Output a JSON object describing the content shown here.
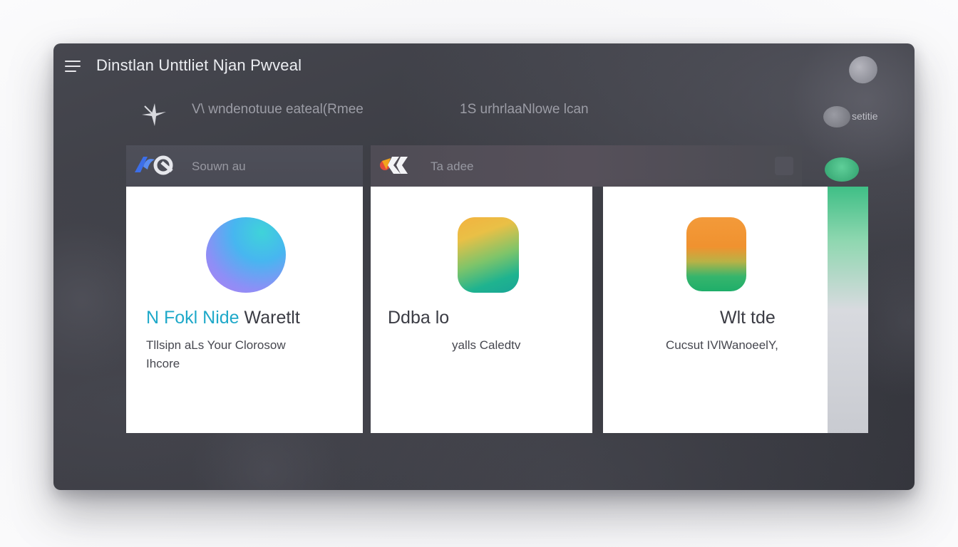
{
  "window": {
    "title": "Dinstlan Unttliet Njan Pwveal"
  },
  "subbar": {
    "text_left": "V\\ wndenotuue eateal(Rmee",
    "text_right": "1S urhrlaaNlowe lcan",
    "settings_label": "setitie"
  },
  "tabs": [
    {
      "label": "Souwn au"
    },
    {
      "label": "Ta adee"
    }
  ],
  "cards": [
    {
      "title_part1": "N  Fokl  Nide",
      "title_part2": "Waretlt",
      "desc_line1": "Tllsipn aLs  Your  Clorosow",
      "desc_line2": "Ihcore"
    },
    {
      "title": "Ddba lo",
      "desc": "yalls Caledtv"
    },
    {
      "title": "Wlt tde",
      "desc": "Cucsut IVlWanoeelY,"
    }
  ],
  "colors": {
    "accent_teal": "#1fa9c9",
    "accent_green": "#3fbf86",
    "window_bg": "#3a3b42"
  },
  "icons": {
    "menu": "hamburger-icon",
    "spark": "spark-icon",
    "avatar": "avatar",
    "tab1_logo": "brand-logo-icon",
    "tab2_logo": "brand-logo-icon",
    "card1": "gradient-circle-icon",
    "card2": "gradient-squircle-icon",
    "card3": "gradient-squircle-icon"
  }
}
